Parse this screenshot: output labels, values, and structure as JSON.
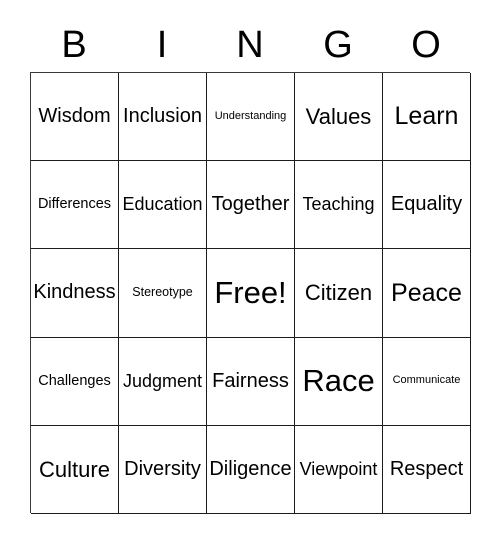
{
  "card": {
    "title": "BINGO",
    "header_letters": [
      "B",
      "I",
      "N",
      "G",
      "O"
    ],
    "free_space_label": "Free!",
    "grid": [
      [
        {
          "label": "Wisdom",
          "size": "md"
        },
        {
          "label": "Inclusion",
          "size": "md"
        },
        {
          "label": "Understanding",
          "size": "tiny"
        },
        {
          "label": "Values",
          "size": "lg"
        },
        {
          "label": "Learn",
          "size": "xl"
        }
      ],
      [
        {
          "label": "Differences",
          "size": "xs"
        },
        {
          "label": "Education",
          "size": "sm"
        },
        {
          "label": "Together",
          "size": "md"
        },
        {
          "label": "Teaching",
          "size": "sm"
        },
        {
          "label": "Equality",
          "size": "md"
        }
      ],
      [
        {
          "label": "Kindness",
          "size": "md"
        },
        {
          "label": "Stereotype",
          "size": "xxs"
        },
        {
          "label": "Free!",
          "size": "xxl"
        },
        {
          "label": "Citizen",
          "size": "lg"
        },
        {
          "label": "Peace",
          "size": "xl"
        }
      ],
      [
        {
          "label": "Challenges",
          "size": "xs"
        },
        {
          "label": "Judgment",
          "size": "sm"
        },
        {
          "label": "Fairness",
          "size": "md"
        },
        {
          "label": "Race",
          "size": "xxl"
        },
        {
          "label": "Communicate",
          "size": "tiny"
        }
      ],
      [
        {
          "label": "Culture",
          "size": "lg"
        },
        {
          "label": "Diversity",
          "size": "md"
        },
        {
          "label": "Diligence",
          "size": "md"
        },
        {
          "label": "Viewpoint",
          "size": "sm"
        },
        {
          "label": "Respect",
          "size": "md"
        }
      ]
    ]
  },
  "colors": {
    "background": "#ffffff",
    "text": "#000000",
    "grid_line": "#1c1c1c"
  }
}
